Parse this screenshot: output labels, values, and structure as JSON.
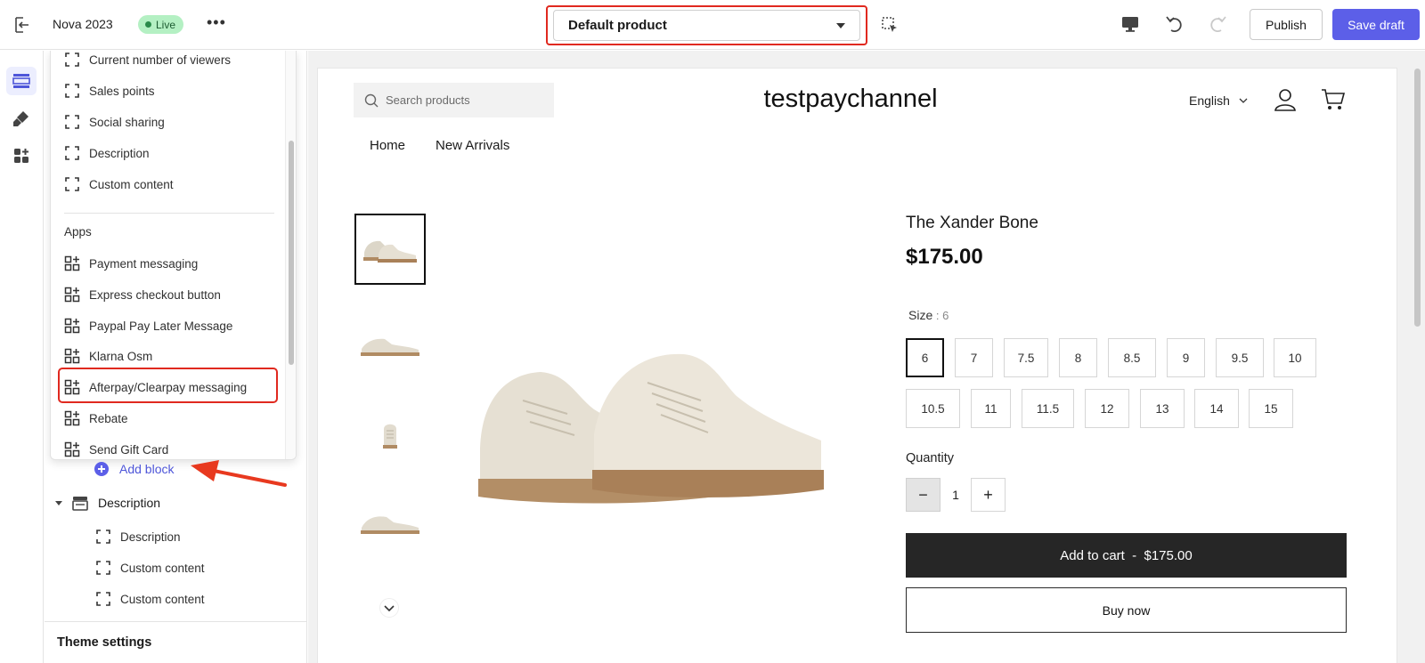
{
  "topbar": {
    "store_name": "Nova 2023",
    "status_badge": "Live",
    "template_selector": "Default product",
    "publish_label": "Publish",
    "save_label": "Save draft"
  },
  "sidebar": {
    "picker_items": [
      "Current number of viewers",
      "Sales points",
      "Social sharing",
      "Description",
      "Custom content"
    ],
    "apps_heading": "Apps",
    "app_items": [
      "Payment messaging",
      "Express checkout button",
      "Paypal Pay Later Message",
      "Klarna Osm",
      "Afterpay/Clearpay messaging",
      "Rebate",
      "Send Gift Card"
    ],
    "add_block_label": "Add block",
    "section_title": "Description",
    "section_blocks": [
      "Description",
      "Custom content",
      "Custom content"
    ],
    "theme_settings_label": "Theme settings"
  },
  "preview": {
    "search_placeholder": "Search products",
    "brand": "testpaychannel",
    "language": "English",
    "nav": [
      "Home",
      "New Arrivals"
    ],
    "product": {
      "title": "The Xander Bone",
      "price": "$175.00",
      "size_label": "Size",
      "size_selected": "6",
      "sizes_row1": [
        "6",
        "7",
        "7.5",
        "8",
        "8.5",
        "9",
        "9.5",
        "10"
      ],
      "sizes_row2": [
        "10.5",
        "11",
        "11.5",
        "12",
        "13",
        "14",
        "15"
      ],
      "quantity_label": "Quantity",
      "quantity": "1",
      "add_to_cart": "Add to cart  -  $175.00",
      "buy_now": "Buy now"
    }
  },
  "colors": {
    "accent": "#5c5fe8",
    "highlight": "#e0291f",
    "live_badge": "#b4f0c3"
  }
}
